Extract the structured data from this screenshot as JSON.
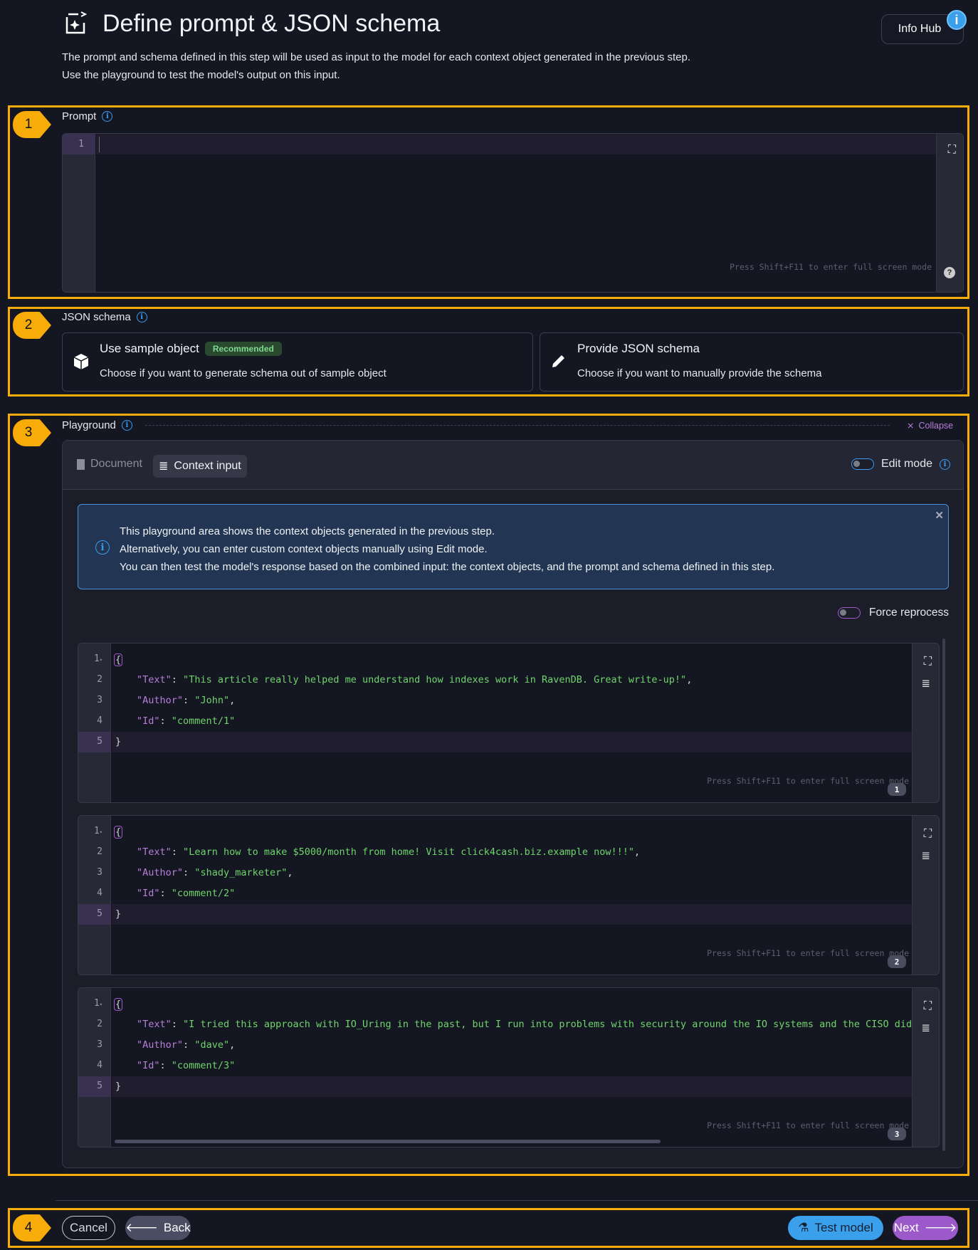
{
  "header": {
    "title": "Define prompt & JSON schema",
    "description_line1": "The prompt and schema defined in this step will be used as input to the model for each context object generated in the previous step.",
    "description_line2": "Use the playground to test the model's output on this input.",
    "info_hub_label": "Info Hub",
    "info_badge": "i"
  },
  "steps": [
    "1",
    "2",
    "3",
    "4"
  ],
  "prompt": {
    "label": "Prompt",
    "line_number": "1",
    "value": "",
    "fullscreen_hint": "Press Shift+F11 to enter full screen mode",
    "help_icon": "?"
  },
  "json_schema": {
    "label": "JSON schema",
    "options": [
      {
        "title": "Use sample object",
        "badge": "Recommended",
        "subtitle": "Choose if you want to generate schema out of sample object",
        "icon": "cube-icon"
      },
      {
        "title": "Provide JSON schema",
        "subtitle": "Choose if you want to manually provide the schema",
        "icon": "pencil-icon"
      }
    ]
  },
  "playground": {
    "label": "Playground",
    "collapse_label": "Collapse",
    "tabs": [
      {
        "label": "Document",
        "active": false
      },
      {
        "label": "Context input",
        "active": true
      }
    ],
    "edit_mode_label": "Edit mode",
    "edit_mode_on": false,
    "alert": {
      "line1": "This playground area shows the context objects generated in the previous step.",
      "line2": "Alternatively, you can enter custom context objects manually using Edit mode.",
      "line3": "You can then test the model's response based on the combined input: the context objects, and the prompt and schema defined in this step."
    },
    "force_reprocess_label": "Force reprocess",
    "force_reprocess_on": false,
    "fullscreen_hint": "Press Shift+F11 to enter full screen mode",
    "objects": [
      {
        "index": "1",
        "text": "This article really helped me understand how indexes work in RavenDB. Great write-up!",
        "author": "John",
        "id": "comment/1"
      },
      {
        "index": "2",
        "text": "Learn how to make $5000/month from home! Visit click4cash.biz.example now!!!",
        "author": "shady_marketer",
        "id": "comment/2"
      },
      {
        "index": "3",
        "text": "I tried this approach with IO_Uring in the past, but I run into problems with security around the IO systems and the CISO didn't l",
        "author": "dave",
        "id": "comment/3"
      }
    ]
  },
  "footer": {
    "cancel_label": "Cancel",
    "back_label": "Back",
    "test_model_label": "Test model",
    "next_label": "Next"
  },
  "colors": {
    "highlight": "#f7ac09",
    "accent_blue": "#3b9bf0",
    "accent_purple": "#9b59c9",
    "string_green": "#6fd46b",
    "key_purple": "#b77ed8"
  }
}
